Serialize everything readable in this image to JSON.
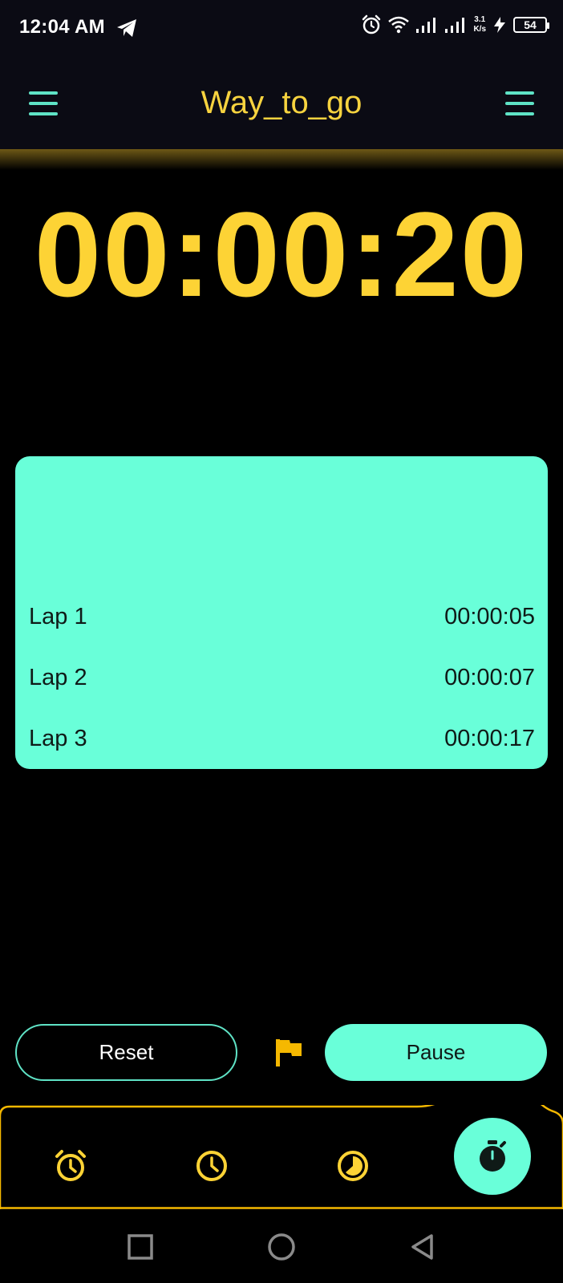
{
  "status_bar": {
    "time": "12:04 AM",
    "net_speed_value": "3.1",
    "net_speed_unit": "K/s",
    "battery": "54",
    "icons": [
      "telegram-icon",
      "alarm-icon",
      "wifi-icon",
      "signal-icon",
      "signal-icon",
      "charging-icon",
      "battery-icon"
    ]
  },
  "app_bar": {
    "title": "Way_to_go",
    "left_icon": "menu-icon",
    "right_icon": "menu-icon"
  },
  "stopwatch": {
    "display": "00:00:20"
  },
  "laps": [
    {
      "label": "Lap 1",
      "time": "00:00:05"
    },
    {
      "label": "Lap 2",
      "time": "00:00:07"
    },
    {
      "label": "Lap 3",
      "time": "00:00:17"
    }
  ],
  "controls": {
    "reset_label": "Reset",
    "pause_label": "Pause",
    "lap_icon": "flag-icon"
  },
  "bottom_nav": {
    "items": [
      "alarm-icon",
      "clock-icon",
      "timer-icon",
      "stopwatch-icon"
    ],
    "active": "stopwatch-icon"
  },
  "system_nav": [
    "recents-icon",
    "home-icon",
    "back-icon"
  ],
  "colors": {
    "accent_yellow": "#fdd335",
    "accent_mint": "#69ffd9",
    "background": "#000000",
    "bar_background": "#0b0b14"
  }
}
